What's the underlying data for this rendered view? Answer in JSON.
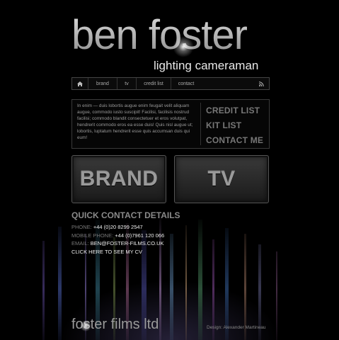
{
  "header": {
    "name": "ben foster",
    "tagline": "lighting cameraman"
  },
  "nav": {
    "home_icon": "home-icon",
    "items": [
      "brand",
      "tv",
      "credit list",
      "contact"
    ],
    "rss_icon": "rss-icon"
  },
  "intro": {
    "text": "In enim — duis lobortis augue enim feugait velit aliquam augue, commodo iusto suscipit! Facilisi, facilisis nostrud facilisi; commodo blandit consectetuer et eros volutpat, hendrerit commodo eros ea esse duis! Quis nisl augue ut; lobortis, luptatum hendrerit esse quis accumsan duis qui eum!"
  },
  "quick_links": [
    "CREDIT LIST",
    "KIT LIST",
    "CONTACT ME"
  ],
  "big_buttons": {
    "brand": "BRAND",
    "tv": "TV"
  },
  "contact": {
    "title": "QUICK CONTACT DETAILS",
    "phone_label": "PHONE:",
    "phone": "+44 (0)20 8299 2547",
    "mobile_label": "MOBILE PHONE:",
    "mobile": "+44 (0)7961 120 066",
    "email_label": "EMAIL:",
    "email": "BEN@FOSTER-FILMS.CO.UK",
    "cv_link": "CLICK HERE TO SEE MY CV"
  },
  "footer": {
    "logo": "foster films ltd",
    "credit": "Design: Alexander Martineau"
  }
}
